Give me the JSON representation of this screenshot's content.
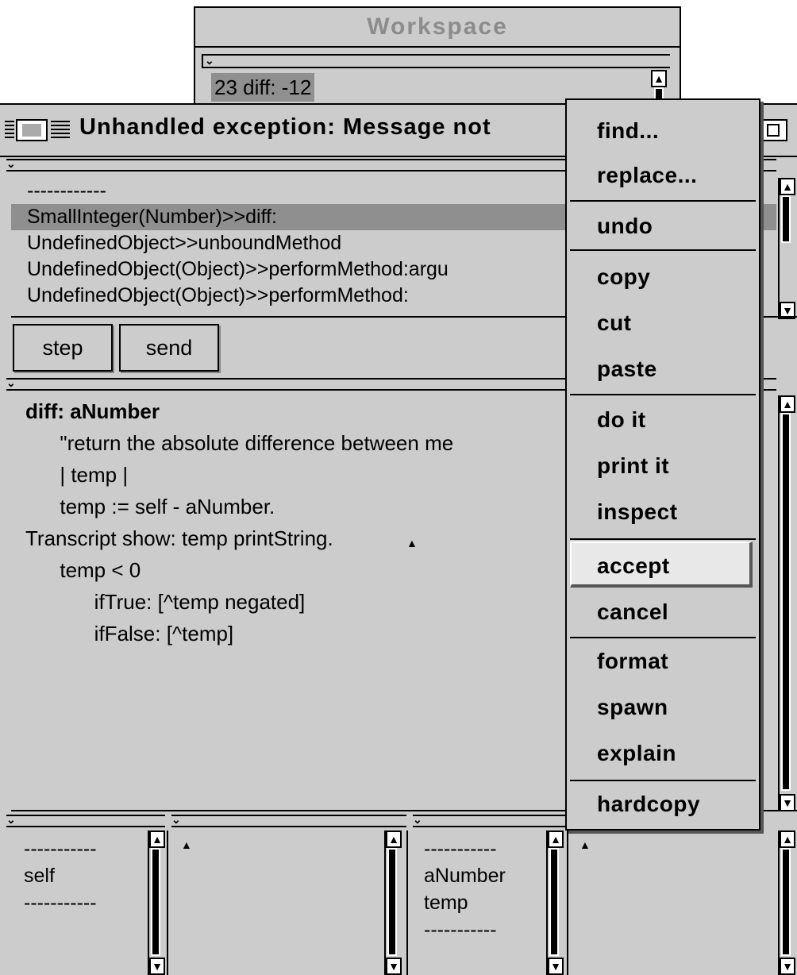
{
  "workspace": {
    "title": "Workspace",
    "text": "23 diff: -12"
  },
  "debugger": {
    "title": "Unhandled exception: Message not",
    "stack": [
      "------------",
      "SmallInteger(Number)>>diff:",
      "UndefinedObject>>unboundMethod",
      "UndefinedObject(Object)>>performMethod:argu",
      "UndefinedObject(Object)>>performMethod:"
    ],
    "selected_stack_index": 1,
    "buttons": {
      "step": "step",
      "send": "send"
    },
    "code": [
      "diff: aNumber",
      "      \"return the absolute difference between me",
      "      | temp |",
      "      temp := self - aNumber.",
      "Transcript show: temp printString.",
      "      temp < 0",
      "            ifTrue: [^temp negated]",
      "            ifFalse: [^temp]"
    ],
    "receiver_vars": {
      "sep_top": "-----------",
      "item": "self",
      "sep_bottom": "-----------"
    },
    "context_vars": {
      "sep_top": "-----------",
      "items": [
        "aNumber",
        "temp"
      ],
      "sep_bottom": "-----------"
    }
  },
  "context_menu": {
    "groups": [
      [
        "find...",
        "replace..."
      ],
      [
        "undo"
      ],
      [
        "copy",
        "cut",
        "paste"
      ],
      [
        "do it",
        "print it",
        "inspect"
      ],
      [
        "accept",
        "cancel"
      ],
      [
        "format",
        "spawn",
        "explain"
      ],
      [
        "hardcopy"
      ]
    ],
    "active_item": "accept"
  }
}
